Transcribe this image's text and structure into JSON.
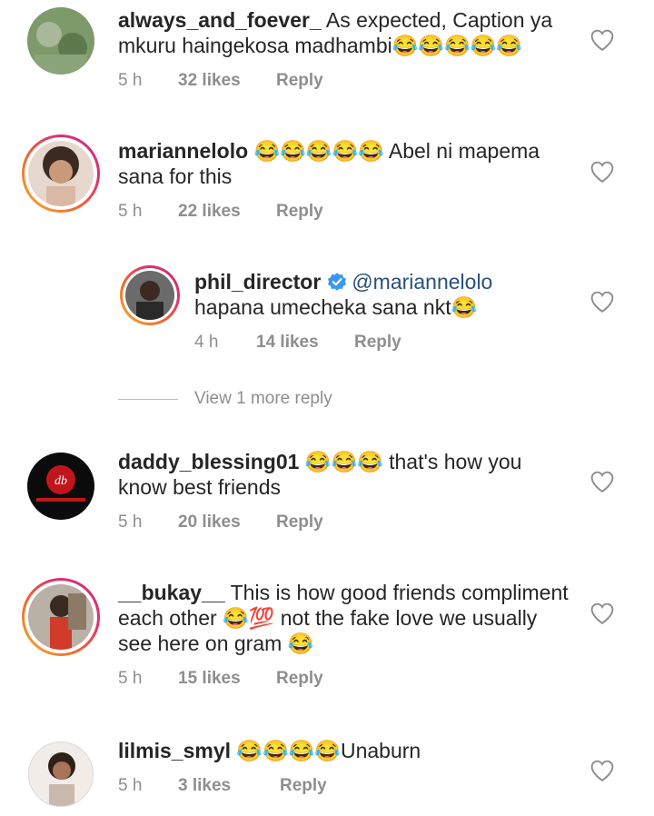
{
  "comments": [
    {
      "username": "always_and_foever_",
      "text": "As expected, Caption ya mkuru haingekosa madhambi😂😂😂😂😂",
      "time": "5 h",
      "likes": "32 likes",
      "reply": "Reply"
    },
    {
      "username": "mariannelolo",
      "text": "😂😂😂😂😂 Abel ni mapema sana for this",
      "time": "5 h",
      "likes": "22 likes",
      "reply": "Reply"
    },
    {
      "username": "phil_director",
      "mention": "@mariannelolo",
      "text": "hapana umecheka sana nkt😂",
      "time": "4 h",
      "likes": "14 likes",
      "reply": "Reply"
    },
    {
      "username": "daddy_blessing01",
      "text": "😂😂😂 that's how you know best friends",
      "time": "5 h",
      "likes": "20 likes",
      "reply": "Reply"
    },
    {
      "username": "__bukay__",
      "text": "This is how good friends compliment each other 😂💯 not the fake love we usually see here on gram 😂",
      "time": "5 h",
      "likes": "15 likes",
      "reply": "Reply"
    },
    {
      "username": "lilmis_smyl",
      "text": "😂😂😂😂Unaburn",
      "time": "5 h",
      "likes": "3 likes",
      "reply": "Reply"
    }
  ],
  "view_more_replies": "View 1 more reply",
  "colors": {
    "text": "#262626",
    "meta": "#8e8e8e",
    "mention": "#2a4f7a",
    "verified": "#3897f0",
    "story_ring_start": "#f9b233",
    "story_ring_end": "#c13584"
  },
  "icons": {
    "like": "heart-outline-icon",
    "verified": "verified-badge-icon"
  }
}
